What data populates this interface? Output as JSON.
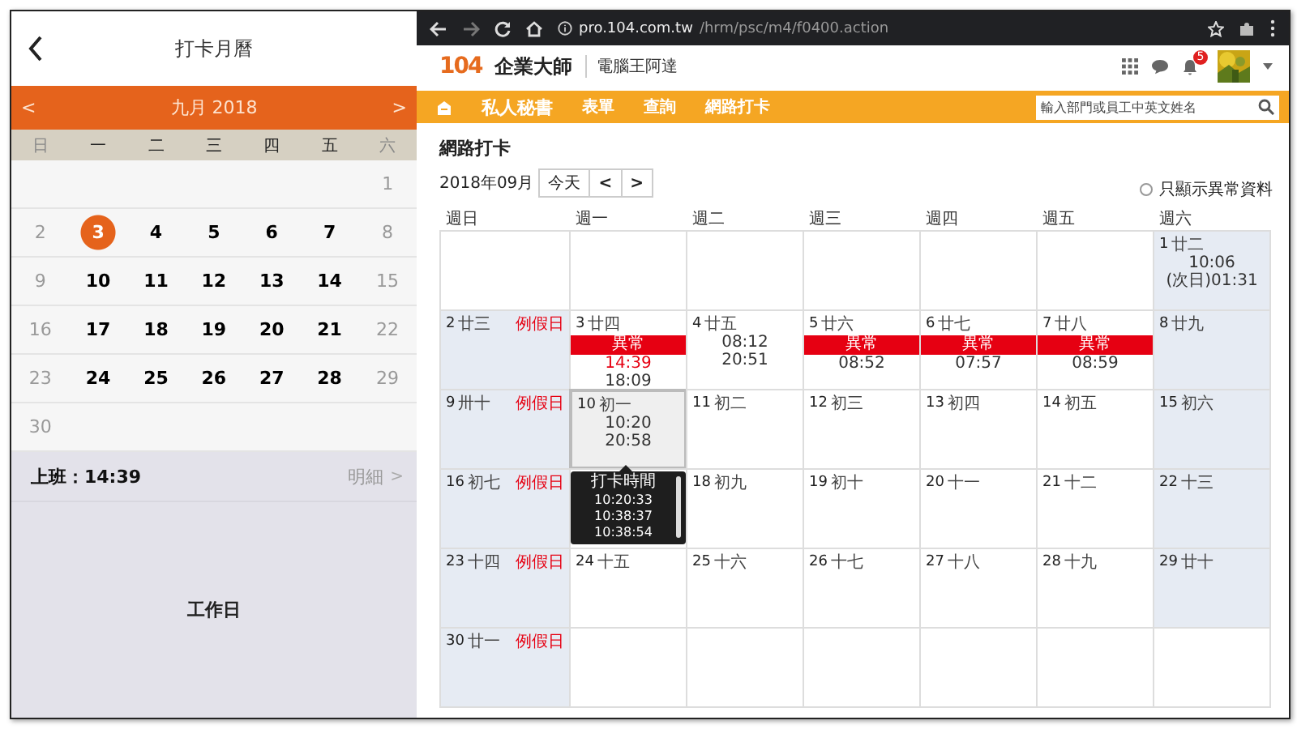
{
  "phone": {
    "title": "打卡月曆",
    "prev": "<",
    "month": "九月 2018",
    "next": ">",
    "weekdays": [
      "日",
      "一",
      "二",
      "三",
      "四",
      "五",
      "六"
    ],
    "weeks": [
      {
        "days": [
          {
            "day": "1",
            "weekend": true,
            "selected": false
          }
        ]
      },
      {
        "days": [
          {
            "day": "2",
            "weekend": true,
            "selected": false
          },
          {
            "day": "3",
            "weekend": false,
            "selected": true
          },
          {
            "day": "4",
            "weekend": false,
            "selected": false
          },
          {
            "day": "5",
            "weekend": false,
            "selected": false
          },
          {
            "day": "6",
            "weekend": false,
            "selected": false
          },
          {
            "day": "7",
            "weekend": false,
            "selected": false
          },
          {
            "day": "8",
            "weekend": true,
            "selected": false
          }
        ]
      },
      {
        "days": [
          {
            "day": "9",
            "weekend": true,
            "selected": false
          },
          {
            "day": "10",
            "weekend": false,
            "selected": false
          },
          {
            "day": "11",
            "weekend": false,
            "selected": false
          },
          {
            "day": "12",
            "weekend": false,
            "selected": false
          },
          {
            "day": "13",
            "weekend": false,
            "selected": false
          },
          {
            "day": "14",
            "weekend": false,
            "selected": false
          },
          {
            "day": "15",
            "weekend": true,
            "selected": false
          }
        ]
      },
      {
        "days": [
          {
            "day": "16",
            "weekend": true,
            "selected": false
          },
          {
            "day": "17",
            "weekend": false,
            "selected": false
          },
          {
            "day": "18",
            "weekend": false,
            "selected": false
          },
          {
            "day": "19",
            "weekend": false,
            "selected": false
          },
          {
            "day": "20",
            "weekend": false,
            "selected": false
          },
          {
            "day": "21",
            "weekend": false,
            "selected": false
          },
          {
            "day": "22",
            "weekend": true,
            "selected": false
          }
        ]
      },
      {
        "days": [
          {
            "day": "23",
            "weekend": true,
            "selected": false
          },
          {
            "day": "24",
            "weekend": false,
            "selected": false
          },
          {
            "day": "25",
            "weekend": false,
            "selected": false
          },
          {
            "day": "26",
            "weekend": false,
            "selected": false
          },
          {
            "day": "27",
            "weekend": false,
            "selected": false
          },
          {
            "day": "28",
            "weekend": false,
            "selected": false
          },
          {
            "day": "29",
            "weekend": true,
            "selected": false
          }
        ]
      },
      {
        "days": [
          {
            "day": "30",
            "weekend": true,
            "selected": false
          }
        ]
      }
    ],
    "clock_in": "上班：14:39",
    "detail": "明細",
    "detail_arrow": ">",
    "day_type": "工作日"
  },
  "browser": {
    "url_host": "pro.104.com.tw",
    "url_path": "/hrm/psc/m4/f0400.action"
  },
  "app": {
    "logo": "104",
    "product": "企業大師",
    "company": "電腦王阿達",
    "notifications": "5",
    "nav": [
      {
        "label": "私人秘書",
        "selected": true
      },
      {
        "label": "表單",
        "selected": false
      },
      {
        "label": "查詢",
        "selected": false
      },
      {
        "label": "網路打卡",
        "selected": false
      }
    ],
    "search": {
      "placeholder": "輸入部門或員工中英文姓名"
    },
    "page_title": "網路打卡",
    "month": "2018年09月",
    "today": "今天",
    "prev": "<",
    "next": ">",
    "filter": {
      "label": "只顯示異常資料",
      "checked": false
    },
    "calendar": {
      "weekdays": [
        "週日",
        "週一",
        "週二",
        "週三",
        "週四",
        "週五",
        "週六"
      ],
      "rows": [
        {
          "cells": [
            {
              "weekend": false,
              "selected": false
            },
            {
              "weekend": false,
              "selected": false
            },
            {
              "weekend": false,
              "selected": false
            },
            {
              "weekend": false,
              "selected": false
            },
            {
              "weekend": false,
              "selected": false
            },
            {
              "weekend": false,
              "selected": false
            },
            {
              "date": "1",
              "lunar": "廿二",
              "weekend": true,
              "selected": false,
              "times": [
                {
                  "text": "10:06",
                  "late": false
                },
                {
                  "text": "(次日)01:31",
                  "late": false
                }
              ]
            }
          ]
        },
        {
          "cells": [
            {
              "date": "2",
              "lunar": "廿三",
              "holiday": "例假日",
              "weekend": true,
              "selected": false
            },
            {
              "date": "3",
              "lunar": "廿四",
              "alert": "異常",
              "weekend": false,
              "selected": false,
              "times": [
                {
                  "text": "14:39",
                  "late": true
                },
                {
                  "text": "18:09",
                  "late": false
                }
              ]
            },
            {
              "date": "4",
              "lunar": "廿五",
              "weekend": false,
              "selected": false,
              "times": [
                {
                  "text": "08:12",
                  "late": false
                },
                {
                  "text": "20:51",
                  "late": false
                }
              ]
            },
            {
              "date": "5",
              "lunar": "廿六",
              "alert": "異常",
              "weekend": false,
              "selected": false,
              "times": [
                {
                  "text": "08:52",
                  "late": false
                }
              ]
            },
            {
              "date": "6",
              "lunar": "廿七",
              "alert": "異常",
              "weekend": false,
              "selected": false,
              "times": [
                {
                  "text": "07:57",
                  "late": false
                }
              ]
            },
            {
              "date": "7",
              "lunar": "廿八",
              "alert": "異常",
              "weekend": false,
              "selected": false,
              "times": [
                {
                  "text": "08:59",
                  "late": false
                }
              ]
            },
            {
              "date": "8",
              "lunar": "廿九",
              "weekend": true,
              "selected": false
            }
          ]
        },
        {
          "cells": [
            {
              "date": "9",
              "lunar": "卅十",
              "holiday": "例假日",
              "weekend": true,
              "selected": false
            },
            {
              "date": "10",
              "lunar": "初一",
              "weekend": false,
              "selected": true,
              "times": [
                {
                  "text": "10:20",
                  "late": false
                },
                {
                  "text": "20:58",
                  "late": false
                }
              ],
              "tooltip": {
                "title": "打卡時間",
                "times": [
                  "10:20:33",
                  "10:38:37",
                  "10:38:54"
                ]
              }
            },
            {
              "date": "11",
              "lunar": "初二",
              "weekend": false,
              "selected": false
            },
            {
              "date": "12",
              "lunar": "初三",
              "weekend": false,
              "selected": false
            },
            {
              "date": "13",
              "lunar": "初四",
              "weekend": false,
              "selected": false
            },
            {
              "date": "14",
              "lunar": "初五",
              "weekend": false,
              "selected": false
            },
            {
              "date": "15",
              "lunar": "初六",
              "weekend": true,
              "selected": false
            }
          ]
        },
        {
          "cells": [
            {
              "date": "16",
              "lunar": "初七",
              "holiday": "例假日",
              "weekend": true,
              "selected": false
            },
            {
              "weekend": false,
              "selected": false
            },
            {
              "date": "18",
              "lunar": "初九",
              "weekend": false,
              "selected": false
            },
            {
              "date": "19",
              "lunar": "初十",
              "weekend": false,
              "selected": false
            },
            {
              "date": "20",
              "lunar": "十一",
              "weekend": false,
              "selected": false
            },
            {
              "date": "21",
              "lunar": "十二",
              "weekend": false,
              "selected": false
            },
            {
              "date": "22",
              "lunar": "十三",
              "weekend": true,
              "selected": false
            }
          ]
        },
        {
          "cells": [
            {
              "date": "23",
              "lunar": "十四",
              "holiday": "例假日",
              "weekend": true,
              "selected": false
            },
            {
              "date": "24",
              "lunar": "十五",
              "weekend": false,
              "selected": false
            },
            {
              "date": "25",
              "lunar": "十六",
              "weekend": false,
              "selected": false
            },
            {
              "date": "26",
              "lunar": "十七",
              "weekend": false,
              "selected": false
            },
            {
              "date": "27",
              "lunar": "十八",
              "weekend": false,
              "selected": false
            },
            {
              "date": "28",
              "lunar": "十九",
              "weekend": false,
              "selected": false
            },
            {
              "date": "29",
              "lunar": "廿十",
              "weekend": true,
              "selected": false
            }
          ]
        },
        {
          "cells": [
            {
              "date": "30",
              "lunar": "廿一",
              "holiday": "例假日",
              "weekend": true,
              "selected": false
            },
            {
              "weekend": false,
              "selected": false
            },
            {
              "weekend": false,
              "selected": false
            },
            {
              "weekend": false,
              "selected": false
            },
            {
              "weekend": false,
              "selected": false
            },
            {
              "weekend": false,
              "selected": false
            },
            {
              "weekend": false,
              "selected": false
            }
          ]
        }
      ]
    }
  }
}
